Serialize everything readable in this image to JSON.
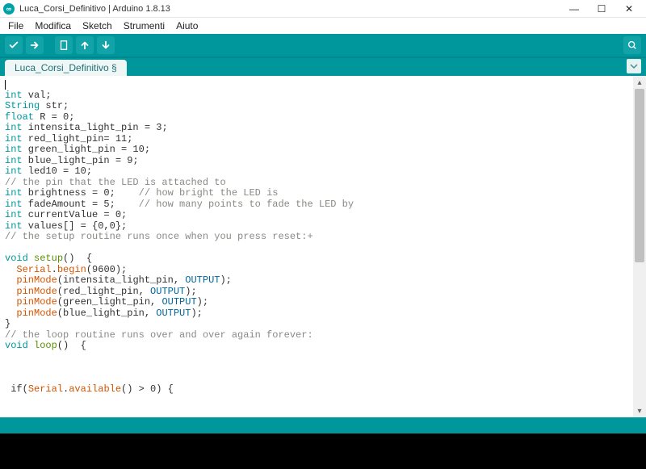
{
  "window": {
    "title": "Luca_Corsi_Definitivo | Arduino 1.8.13",
    "app_icon_glyph": "∞"
  },
  "win_controls": {
    "min": "—",
    "max": "☐",
    "close": "✕"
  },
  "menu": {
    "items": [
      "File",
      "Modifica",
      "Sketch",
      "Strumenti",
      "Aiuto"
    ]
  },
  "toolbar": {
    "verify": "verify",
    "upload": "upload",
    "new": "new",
    "open": "open",
    "save": "save",
    "serial": "serial-monitor"
  },
  "tabs": {
    "items": [
      {
        "label": "Luca_Corsi_Definitivo §"
      }
    ]
  },
  "code_tokens": [
    [
      {
        "t": "caret"
      }
    ],
    [
      {
        "c": "tok-type",
        "t": "int"
      },
      {
        "t": " val;"
      }
    ],
    [
      {
        "c": "tok-type",
        "t": "String"
      },
      {
        "t": " str;"
      }
    ],
    [
      {
        "c": "tok-type",
        "t": "float"
      },
      {
        "t": " R = 0;"
      }
    ],
    [
      {
        "c": "tok-type",
        "t": "int"
      },
      {
        "t": " intensita_light_pin = 3;"
      }
    ],
    [
      {
        "c": "tok-type",
        "t": "int"
      },
      {
        "t": " red_light_pin= 11;"
      }
    ],
    [
      {
        "c": "tok-type",
        "t": "int"
      },
      {
        "t": " green_light_pin = 10;"
      }
    ],
    [
      {
        "c": "tok-type",
        "t": "int"
      },
      {
        "t": " blue_light_pin = 9;"
      }
    ],
    [
      {
        "c": "tok-type",
        "t": "int"
      },
      {
        "t": " led10 = 10;"
      }
    ],
    [
      {
        "c": "tok-comment",
        "t": "// the pin that the LED is attached to"
      }
    ],
    [
      {
        "c": "tok-type",
        "t": "int"
      },
      {
        "t": " brightness = 0;    "
      },
      {
        "c": "tok-comment",
        "t": "// how bright the LED is"
      }
    ],
    [
      {
        "c": "tok-type",
        "t": "int"
      },
      {
        "t": " fadeAmount = 5;    "
      },
      {
        "c": "tok-comment",
        "t": "// how many points to fade the LED by"
      }
    ],
    [
      {
        "c": "tok-type",
        "t": "int"
      },
      {
        "t": " currentValue = 0;"
      }
    ],
    [
      {
        "c": "tok-type",
        "t": "int"
      },
      {
        "t": " values[] = {0,0};"
      }
    ],
    [
      {
        "c": "tok-comment",
        "t": "// the setup routine runs once when you press reset:+"
      }
    ],
    [
      {
        "t": " "
      }
    ],
    [
      {
        "c": "tok-type",
        "t": "void"
      },
      {
        "t": " "
      },
      {
        "c": "tok-kw",
        "t": "setup"
      },
      {
        "t": "()  {"
      }
    ],
    [
      {
        "t": "  "
      },
      {
        "c": "tok-func",
        "t": "Serial"
      },
      {
        "t": "."
      },
      {
        "c": "tok-func",
        "t": "begin"
      },
      {
        "t": "(9600);"
      }
    ],
    [
      {
        "t": "  "
      },
      {
        "c": "tok-func",
        "t": "pinMode"
      },
      {
        "t": "(intensita_light_pin, "
      },
      {
        "c": "tok-const",
        "t": "OUTPUT"
      },
      {
        "t": ");"
      }
    ],
    [
      {
        "t": "  "
      },
      {
        "c": "tok-func",
        "t": "pinMode"
      },
      {
        "t": "(red_light_pin, "
      },
      {
        "c": "tok-const",
        "t": "OUTPUT"
      },
      {
        "t": ");"
      }
    ],
    [
      {
        "t": "  "
      },
      {
        "c": "tok-func",
        "t": "pinMode"
      },
      {
        "t": "(green_light_pin, "
      },
      {
        "c": "tok-const",
        "t": "OUTPUT"
      },
      {
        "t": ");"
      }
    ],
    [
      {
        "t": "  "
      },
      {
        "c": "tok-func",
        "t": "pinMode"
      },
      {
        "t": "(blue_light_pin, "
      },
      {
        "c": "tok-const",
        "t": "OUTPUT"
      },
      {
        "t": ");"
      }
    ],
    [
      {
        "t": "}"
      }
    ],
    [
      {
        "c": "tok-comment",
        "t": "// the loop routine runs over and over again forever:"
      }
    ],
    [
      {
        "c": "tok-type",
        "t": "void"
      },
      {
        "t": " "
      },
      {
        "c": "tok-kw",
        "t": "loop"
      },
      {
        "t": "()  {"
      }
    ],
    [
      {
        "t": " "
      }
    ],
    [
      {
        "t": " "
      }
    ],
    [
      {
        "t": " "
      }
    ],
    [
      {
        "t": " if("
      },
      {
        "c": "tok-func",
        "t": "Serial"
      },
      {
        "t": "."
      },
      {
        "c": "tok-func",
        "t": "available"
      },
      {
        "t": "() > 0) {"
      }
    ]
  ]
}
